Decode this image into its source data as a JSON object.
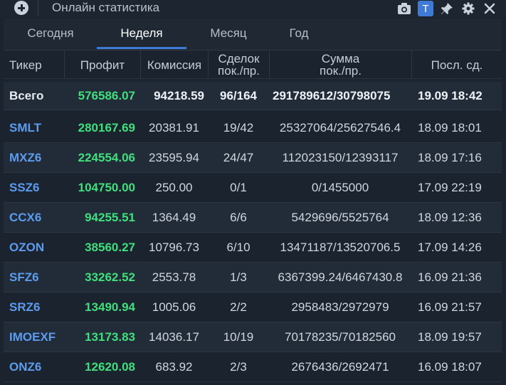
{
  "window": {
    "title": "Онлайн статистика",
    "badge": "T",
    "accent": "#3e7ad6",
    "profit_color": "#3fe07c",
    "ticker_color": "#5b9cf0",
    "icons": [
      "add-icon",
      "camera-icon",
      "pin-icon",
      "settings-icon",
      "close-icon"
    ]
  },
  "tabs": [
    {
      "label": "Сегодня",
      "active": false
    },
    {
      "label": "Неделя",
      "active": true
    },
    {
      "label": "Месяц",
      "active": false
    },
    {
      "label": "Год",
      "active": false
    }
  ],
  "table": {
    "headers": {
      "ticker": "Тикер",
      "profit": "Профит",
      "commission": "Комиссия",
      "deals_line1": "Сделок",
      "deals_line2": "пок./пр.",
      "sum_line1": "Сумма",
      "sum_line2": "пок./пр.",
      "last": "Посл. сд."
    },
    "total": {
      "ticker": "Всего",
      "profit": "576586.07",
      "commission": "94218.59",
      "deals": "96/164",
      "sum": "291789612/30798075",
      "last": "19.09 18:42"
    },
    "rows": [
      {
        "ticker": "SMLT",
        "profit": "280167.69",
        "commission": "20381.91",
        "deals": "19/42",
        "sum": "25327064/25627546.4",
        "last": "18.09 18:01"
      },
      {
        "ticker": "MXZ6",
        "profit": "224554.06",
        "commission": "23595.94",
        "deals": "24/47",
        "sum": "112023150/12393117",
        "last": "18.09 17:16"
      },
      {
        "ticker": "SSZ6",
        "profit": "104750.00",
        "commission": "250.00",
        "deals": "0/1",
        "sum": "0/1455000",
        "last": "17.09 22:19"
      },
      {
        "ticker": "CCX6",
        "profit": "94255.51",
        "commission": "1364.49",
        "deals": "6/6",
        "sum": "5429696/5525764",
        "last": "18.09 12:36"
      },
      {
        "ticker": "OZON",
        "profit": "38560.27",
        "commission": "10796.73",
        "deals": "6/10",
        "sum": "13471187/13520706.5",
        "last": "17.09 14:26"
      },
      {
        "ticker": "SFZ6",
        "profit": "33262.52",
        "commission": "2553.78",
        "deals": "1/3",
        "sum": "6367399.24/6467430.8",
        "last": "16.09 21:36"
      },
      {
        "ticker": "SRZ6",
        "profit": "13490.94",
        "commission": "1005.06",
        "deals": "2/2",
        "sum": "2958483/2972979",
        "last": "16.09 21:57"
      },
      {
        "ticker": "IMOEXF",
        "profit": "13173.83",
        "commission": "14036.17",
        "deals": "10/19",
        "sum": "70178235/70182560",
        "last": "18.09 19:57"
      },
      {
        "ticker": "ONZ6",
        "profit": "12620.08",
        "commission": "683.92",
        "deals": "2/3",
        "sum": "2676436/2692471",
        "last": "16.09 18:07"
      }
    ]
  }
}
